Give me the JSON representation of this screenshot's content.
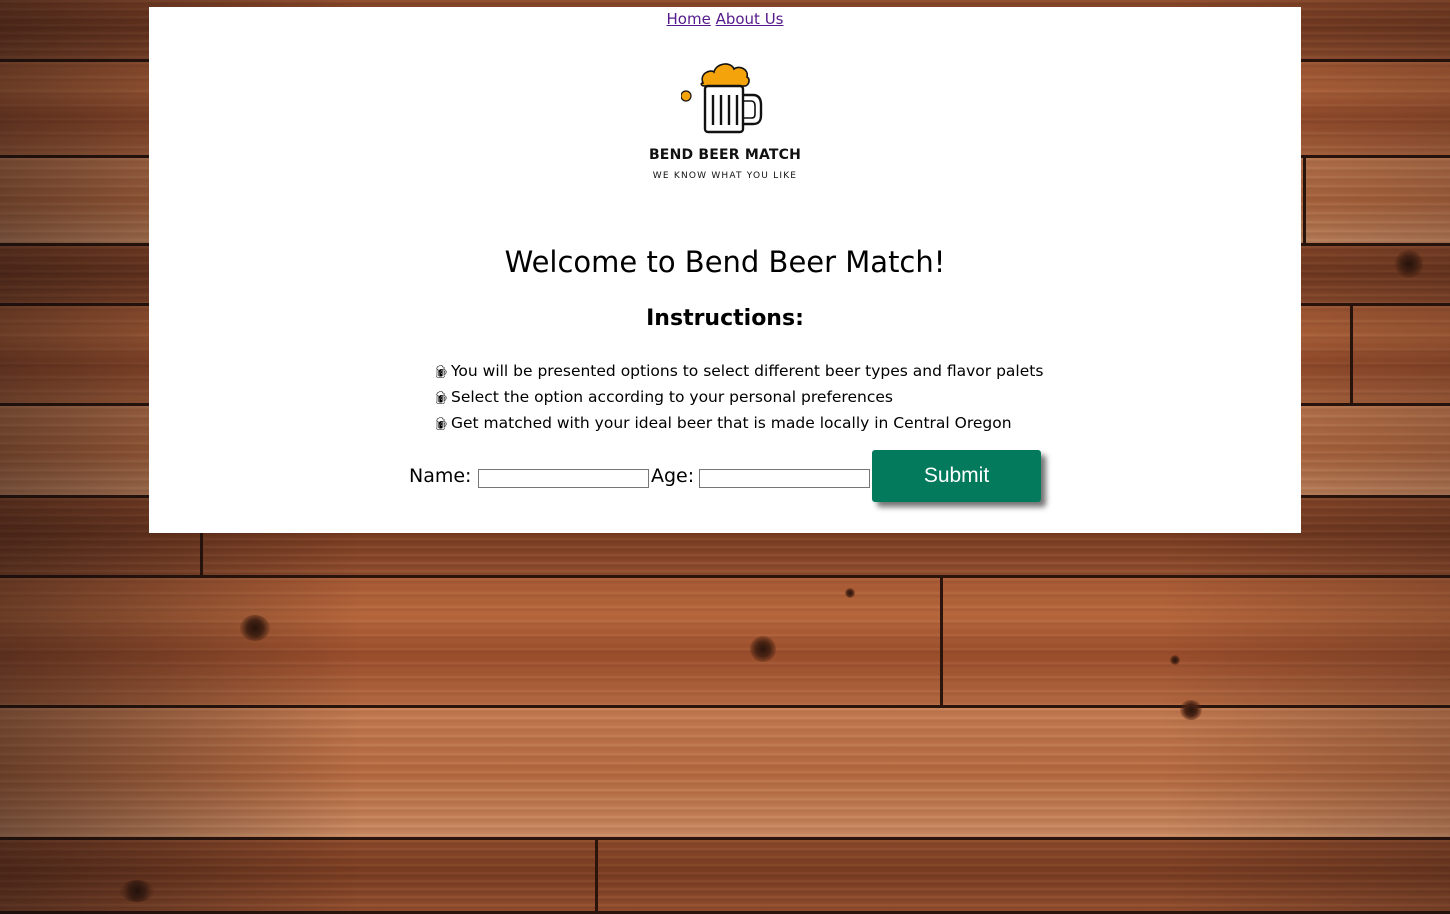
{
  "nav": {
    "home_label": "Home",
    "about_label": "About Us"
  },
  "logo": {
    "title": "BEND BEER MATCH",
    "tagline": "WE KNOW WHAT YOU LIKE",
    "icon": "beer-mug-icon",
    "foam_color": "#f5a30a"
  },
  "main": {
    "welcome": "Welcome to Bend Beer Match!",
    "instructions_title": "Instructions:",
    "instructions": [
      "You will be presented options to select different beer types and flavor palets",
      "Select the option according to your personal preferences",
      "Get matched with your ideal beer that is made locally in Central Oregon"
    ],
    "bullet_icon": "mug-bullet-icon"
  },
  "form": {
    "name_label": "Name:",
    "name_value": "",
    "age_label": "Age:",
    "age_value": "",
    "submit_label": "Submit",
    "submit_color": "#047a5d"
  },
  "colors": {
    "link": "#551a8b",
    "background": "#7c4024"
  }
}
